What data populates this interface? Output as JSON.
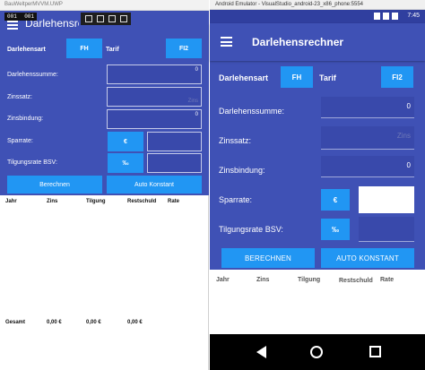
{
  "uwp": {
    "window_title": "BauWeltperMVVM.UWP",
    "counter": [
      "001",
      "001"
    ],
    "header_title": "Darlehensrechner",
    "fields": {
      "darlehensart_label": "Darlehensart",
      "fh_button": "FH",
      "tarif_label": "Tarif",
      "fi2_button": "FI2",
      "darlehenssumme_label": "Darlehenssumme:",
      "darlehenssumme_value": "0",
      "zinssatz_label": "Zinssatz:",
      "zinssatz_placeholder": "Zins",
      "zinsbindung_label": "Zinsbindung:",
      "zinsbindung_value": "0",
      "sparrate_label": "Sparrate:",
      "euro_button": "€",
      "tilgungsrate_label": "Tilgungsrate BSV:",
      "permille_button": "‰"
    },
    "actions": {
      "berechnen": "Berechnen",
      "auto_konstant": "Auto Konstant"
    },
    "table_headers": [
      "Jahr",
      "Zins",
      "Tilgung",
      "Restschuld",
      "Rate"
    ],
    "totals": {
      "label": "Gesamt",
      "zins": "0,00 €",
      "tilgung": "0,00 €",
      "restschuld": "0,00 €"
    }
  },
  "emulator": {
    "window_title": "Android Emulator - VisualStudio_android-23_x86_phone:5554",
    "time": "7:45",
    "appbar_title": "Darlehensrechner",
    "fields": {
      "darlehensart_label": "Darlehensart",
      "fh_button": "FH",
      "tarif_label": "Tarif",
      "fi2_button": "FI2",
      "darlehenssumme_label": "Darlehenssumme:",
      "darlehenssumme_value": "0",
      "zinssatz_label": "Zinssatz:",
      "zinssatz_placeholder": "Zins",
      "zinsbindung_label": "Zinsbindung:",
      "zinsbindung_value": "0",
      "sparrate_label": "Sparrate:",
      "euro_button": "€",
      "tilgungsrate_label": "Tilgungsrate BSV:",
      "permille_button": "‰"
    },
    "actions": {
      "berechnen": "BERECHNEN",
      "auto_konstant": "AUTO KONSTANT"
    },
    "table_headers": [
      "Jahr",
      "Zins",
      "Tilgung",
      "Restschuld",
      "Rate"
    ],
    "nav_icons": [
      "back-icon",
      "home-icon",
      "recent-apps-icon"
    ]
  },
  "colors": {
    "primary": "#3f51b5",
    "primary_dark": "#303f9f",
    "accent": "#2196f3"
  }
}
